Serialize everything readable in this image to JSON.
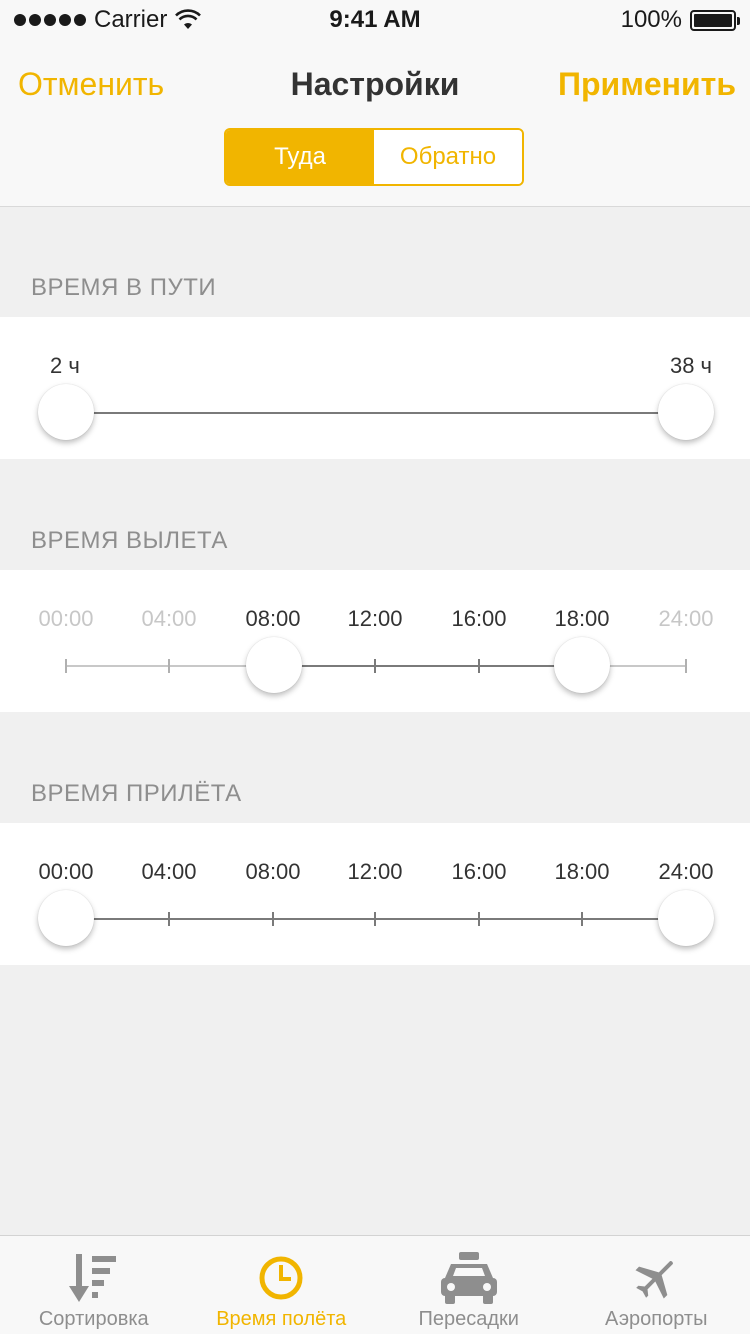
{
  "status_bar": {
    "carrier": "Carrier",
    "time": "9:41 AM",
    "battery": "100%"
  },
  "nav": {
    "cancel": "Отменить",
    "title": "Настройки",
    "apply": "Применить"
  },
  "segments": {
    "active": "Туда",
    "inactive": "Обратно"
  },
  "travel_time": {
    "title": "ВРЕМЯ В ПУТИ",
    "min_label": "2 ч",
    "max_label": "38 ч",
    "min_value": 2,
    "max_value": 38
  },
  "departure": {
    "title": "ВРЕМЯ ВЫЛЕТА",
    "ticks": [
      "00:00",
      "04:00",
      "08:00",
      "12:00",
      "16:00",
      "18:00",
      "24:00"
    ],
    "selected_from": "08:00",
    "selected_to": "18:00"
  },
  "arrival": {
    "title": "ВРЕМЯ ПРИЛЁТА",
    "ticks": [
      "00:00",
      "04:00",
      "08:00",
      "12:00",
      "16:00",
      "18:00",
      "24:00"
    ],
    "selected_from": "00:00",
    "selected_to": "24:00"
  },
  "tabbar": {
    "sorting": "Сортировка",
    "flight_time": "Время полёта",
    "transfers": "Пересадки",
    "airports": "Аэропорты",
    "active": "flight_time"
  },
  "colors": {
    "accent": "#f1b500",
    "inactive_tab": "#8e8e8e",
    "background": "#f0f0f0"
  }
}
